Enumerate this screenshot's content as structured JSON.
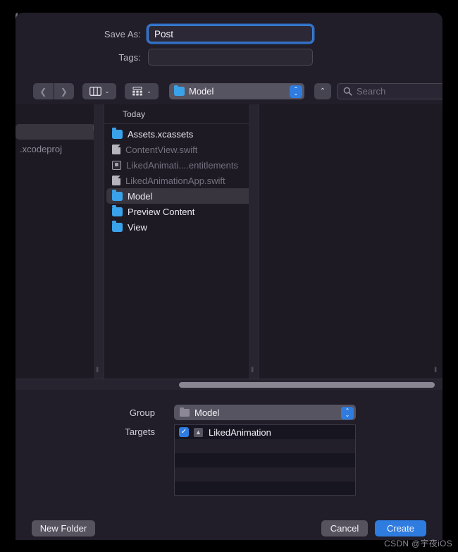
{
  "dialog": {
    "save_as_label": "Save As:",
    "save_as_value": "Post",
    "tags_label": "Tags:",
    "tags_value": "",
    "tags_placeholder": ""
  },
  "toolbar": {
    "back_icon": "chevron-left-icon",
    "forward_icon": "chevron-right-icon",
    "columns_view_caret": "⌄",
    "gallery_view_caret": "⌄",
    "path_popup_label": "Model",
    "stepper_up": "⌃",
    "stepper_down": "⌄",
    "up_button_icon": "⌃",
    "search_placeholder": "Search"
  },
  "browser": {
    "column1": {
      "stub_chevron": "›",
      "stub_label": ".xcodeproj"
    },
    "column2": {
      "group_header": "Today",
      "items": [
        {
          "name": "Assets.xcassets",
          "icon": "folder",
          "dim": false,
          "selected": false,
          "chevron": "›"
        },
        {
          "name": "ContentView.swift",
          "icon": "doc",
          "dim": true,
          "selected": false,
          "chevron": ""
        },
        {
          "name": "LikedAnimati....entitlements",
          "icon": "entitlements",
          "dim": true,
          "selected": false,
          "chevron": ""
        },
        {
          "name": "LikedAnimationApp.swift",
          "icon": "doc",
          "dim": true,
          "selected": false,
          "chevron": ""
        },
        {
          "name": "Model",
          "icon": "folder",
          "dim": false,
          "selected": true,
          "chevron": "›"
        },
        {
          "name": "Preview Content",
          "icon": "folder",
          "dim": false,
          "selected": false,
          "chevron": "›"
        },
        {
          "name": "View",
          "icon": "folder",
          "dim": false,
          "selected": false,
          "chevron": "›"
        }
      ]
    },
    "grip_glyph": "‖"
  },
  "accessory": {
    "group_label": "Group",
    "group_value": "Model",
    "targets_label": "Targets",
    "targets": [
      {
        "name": "LikedAnimation",
        "checked": true,
        "check_glyph": "✓",
        "app_glyph": "▲"
      }
    ]
  },
  "buttons": {
    "new_folder": "New Folder",
    "cancel": "Cancel",
    "create": "Create"
  },
  "watermark": "CSDN @宇夜iOS",
  "colors": {
    "accent_blue": "#2f7ce0",
    "focus_ring": "#2f6fc4",
    "folder_blue": "#3aa2e8",
    "panel_bg": "#211d29",
    "browser_bg": "#1d1a24",
    "selection_grey": "#39353f"
  }
}
